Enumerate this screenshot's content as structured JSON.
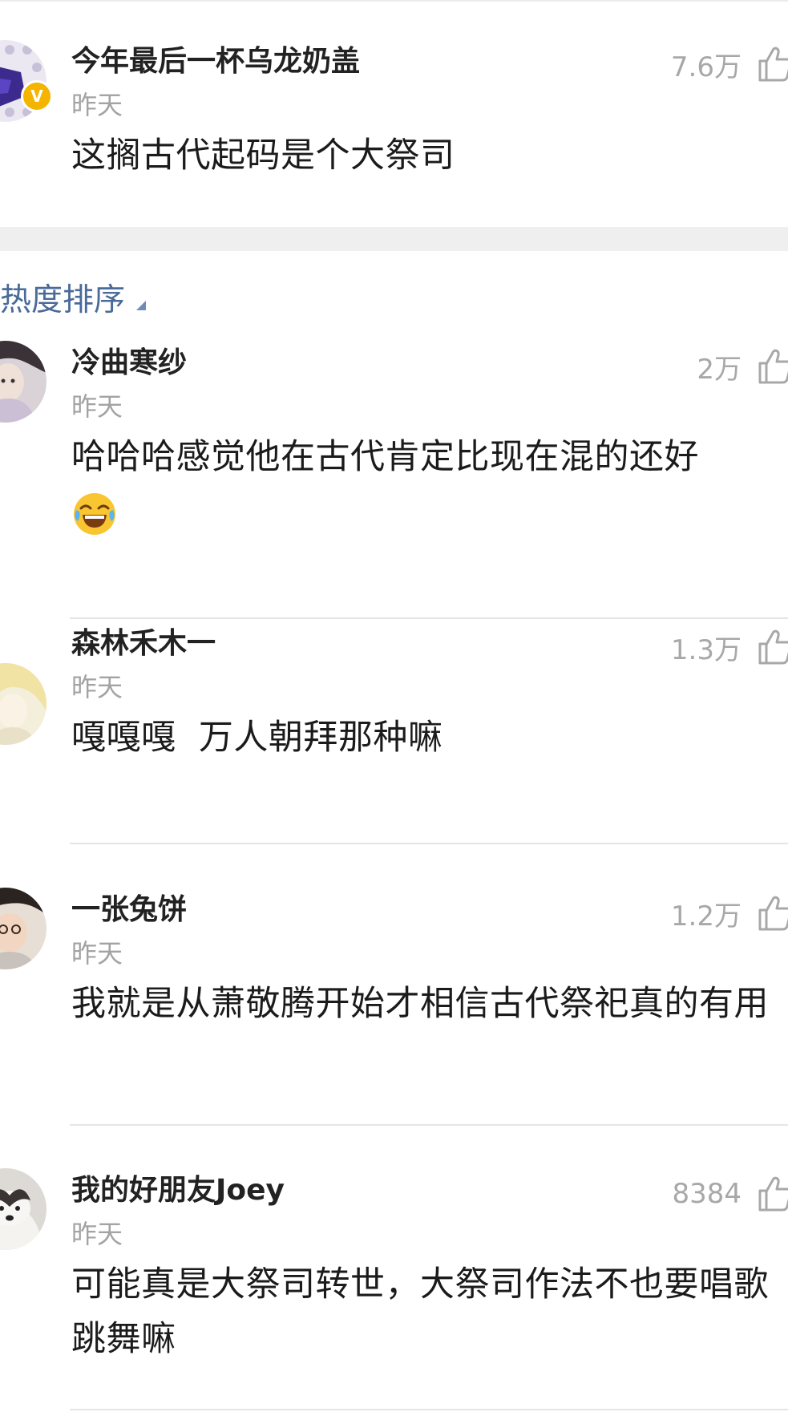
{
  "top_comment": {
    "username": "今年最后一杯乌龙奶盖",
    "time": "昨天",
    "likes": "7.6万",
    "content": "这搁古代起码是个大祭司",
    "verified_badge": "V"
  },
  "sort": {
    "label": "热度排序"
  },
  "comments": [
    {
      "username": "冷曲寒纱",
      "time": "昨天",
      "likes": "2万",
      "content": "哈哈哈感觉他在古代肯定比现在混的还好",
      "emoji": "laughing-tears-emoji"
    },
    {
      "username": "森林禾木一",
      "time": "昨天",
      "likes": "1.3万",
      "content": "嘎嘎嘎  万人朝拜那种嘛"
    },
    {
      "username": "一张兔饼",
      "time": "昨天",
      "likes": "1.2万",
      "content": "我就是从萧敬腾开始才相信古代祭祀真的有用"
    },
    {
      "username": "我的好朋友Joey",
      "time": "昨天",
      "likes": "8384",
      "content": "可能真是大祭司转世，大祭司作法不也要唱歌跳舞嘛"
    }
  ],
  "colors": {
    "username": "#222222",
    "time": "#a3a3a3",
    "likes": "#a8a8a8",
    "sort_link": "#4a6a99",
    "divider": "#e5e5e5",
    "section_gap": "#efefef",
    "verified": "#f4b400"
  },
  "icons": {
    "like": "thumbs-up-outline-icon",
    "sort": "triangle-down-icon",
    "verified": "verified-badge-icon"
  }
}
